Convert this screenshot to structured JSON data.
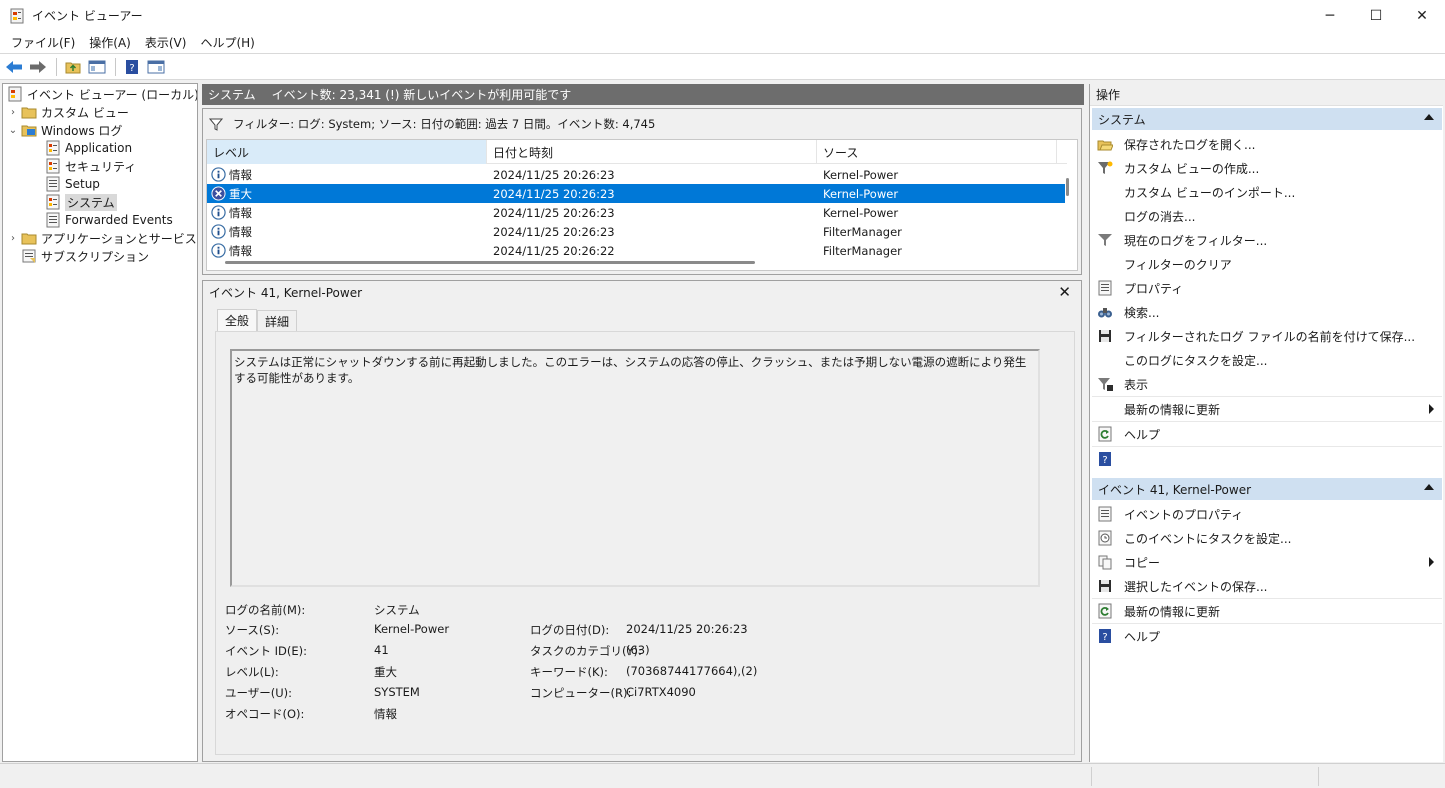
{
  "window": {
    "title": "イベント ビューアー",
    "controls": {
      "minimize": "─",
      "maximize": "☐",
      "close": "✕"
    }
  },
  "menu": [
    "ファイル(F)",
    "操作(A)",
    "表示(V)",
    "ヘルプ(H)"
  ],
  "toolbar": {
    "buttons": [
      "back-icon",
      "forward-icon",
      "folder-up-icon",
      "show-hide-tree-icon",
      "help-icon",
      "show-hide-action-icon"
    ]
  },
  "tree": {
    "root": "イベント ビューアー (ローカル)",
    "custom_views": "カスタム ビュー",
    "windows_logs": "Windows ログ",
    "logs": [
      "Application",
      "セキュリティ",
      "Setup",
      "システム",
      "Forwarded Events"
    ],
    "app_service_logs": "アプリケーションとサービス ログ",
    "subscriptions": "サブスクリプション"
  },
  "center": {
    "log_name": "システム",
    "summary": "イベント数: 23,341 (!) 新しいイベントが利用可能です",
    "filter_text": "フィルター: ログ: System; ソース: 日付の範囲: 過去 7 日間。イベント数: 4,745",
    "columns": [
      "レベル",
      "日付と時刻",
      "ソース"
    ],
    "rows": [
      {
        "level": "情報",
        "date": "2024/11/25 20:26:23",
        "source": "Kernel-Power",
        "type": "info"
      },
      {
        "level": "重大",
        "date": "2024/11/25 20:26:23",
        "source": "Kernel-Power",
        "type": "critical"
      },
      {
        "level": "情報",
        "date": "2024/11/25 20:26:23",
        "source": "Kernel-Power",
        "type": "info"
      },
      {
        "level": "情報",
        "date": "2024/11/25 20:26:23",
        "source": "FilterManager",
        "type": "info"
      },
      {
        "level": "情報",
        "date": "2024/11/25 20:26:22",
        "source": "FilterManager",
        "type": "info"
      }
    ]
  },
  "detail": {
    "header": "イベント 41, Kernel-Power",
    "close": "✕",
    "tabs": [
      "全般",
      "詳細"
    ],
    "description": "システムは正常にシャットダウンする前に再起動しました。このエラーは、システムの応答の停止、クラッシュ、または予期しない電源の遮断により発生する可能性があります。",
    "fields": {
      "log_name_label": "ログの名前(M):",
      "log_name": "システム",
      "source_label": "ソース(S):",
      "source": "Kernel-Power",
      "logged_label": "ログの日付(D):",
      "logged": "2024/11/25 20:26:23",
      "event_id_label": "イベント ID(E):",
      "event_id": "41",
      "task_label": "タスクのカテゴリ(Y):",
      "task": "(63)",
      "level_label": "レベル(L):",
      "level": "重大",
      "keywords_label": "キーワード(K):",
      "keywords": "(70368744177664),(2)",
      "user_label": "ユーザー(U):",
      "user": "SYSTEM",
      "computer_label": "コンピューター(R):",
      "computer": "Ci7RTX4090",
      "opcode_label": "オペコード(O):",
      "opcode": "情報"
    }
  },
  "actions": {
    "title": "操作",
    "section1": "システム",
    "items1": [
      "保存されたログを開く...",
      "カスタム ビューの作成...",
      "カスタム ビューのインポート...",
      "ログの消去...",
      "現在のログをフィルター...",
      "フィルターのクリア",
      "プロパティ",
      "検索...",
      "フィルターされたログ ファイルの名前を付けて保存...",
      "このログにタスクを設定...",
      "表示",
      "最新の情報に更新",
      "ヘルプ"
    ],
    "section2": "イベント 41, Kernel-Power",
    "items2": [
      "イベントのプロパティ",
      "このイベントにタスクを設定...",
      "コピー",
      "選択したイベントの保存...",
      "最新の情報に更新",
      "ヘルプ"
    ]
  },
  "colors": {
    "selection": "#0078d7",
    "section_header": "#cfe0f1",
    "center_header": "#6d6d6d"
  }
}
